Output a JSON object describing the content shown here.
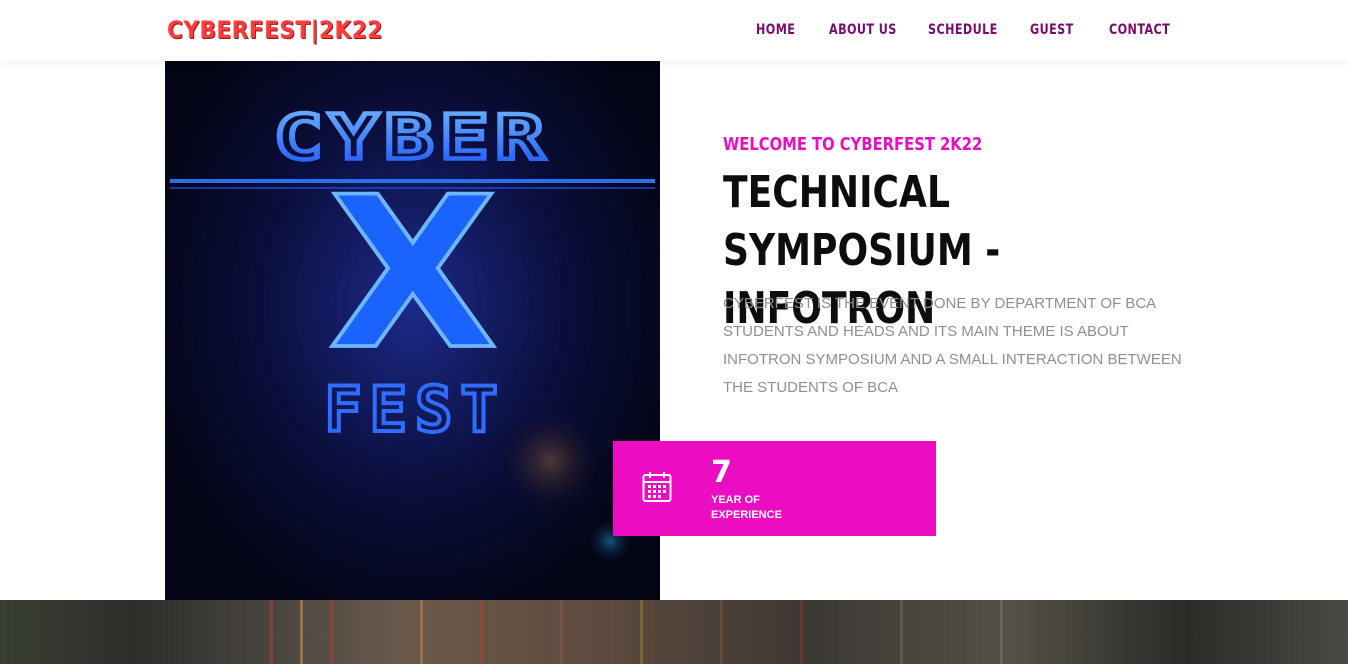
{
  "header": {
    "brand": "CYBERFEST|2K22",
    "nav": [
      {
        "label": "HOME"
      },
      {
        "label": "ABOUT US"
      },
      {
        "label": "SCHEDULE"
      },
      {
        "label": "GUEST"
      },
      {
        "label": "CONTACT"
      }
    ]
  },
  "hero": {
    "kicker": "WELCOME TO CYBERFEST 2K22",
    "title_line1": "TECHNICAL SYMPOSIUM -",
    "title_line2": "INFOTRON",
    "description": "CYBERFEST IS THE EVENT DONE BY DEPARTMENT OF BCA STUDENTS AND HEADS AND ITS MAIN THEME IS ABOUT INFOTRON SYMPOSIUM AND A SMALL INTERACTION BETWEEN THE STUDENTS OF BCA",
    "image_text_top": "CYBER",
    "image_text_mid": "X",
    "image_text_bottom": "FEST"
  },
  "experience": {
    "icon": "calendar-icon",
    "number": "7",
    "label": "YEAR OF EXPERIENCE"
  },
  "colors": {
    "accent": "#ec0cc1",
    "nav": "#7a0b6e",
    "brand": "#ff3b3b"
  }
}
